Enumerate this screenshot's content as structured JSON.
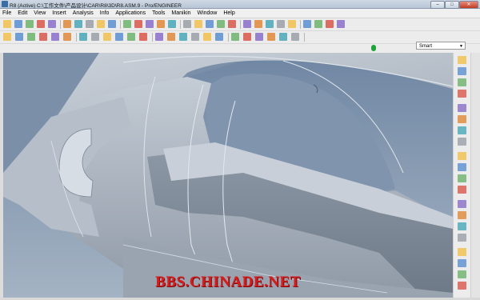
{
  "window": {
    "title": "R8 (Active) C:\\工作文件\\产品设计\\CAR\\R8\\3D\\R8.ASM.9 - Pro/ENGINEER",
    "minimize": "–",
    "maximize": "□",
    "close": "✕"
  },
  "menu": [
    "File",
    "Edit",
    "View",
    "Insert",
    "Analysis",
    "Info",
    "Applications",
    "Tools",
    "Manikin",
    "Window",
    "Help"
  ],
  "toolbar": {
    "row1_icons": [
      "new-icon",
      "open-icon",
      "save-icon",
      "print-icon",
      "email-icon",
      "copy-icon",
      "paste-icon",
      "repaint-icon",
      "spin-center-icon",
      "orient-icon",
      "model-tree-icon",
      "layer-icon",
      "view-manager-icon",
      "datum-plane-icon",
      "datum-axis-icon",
      "datum-point-icon",
      "csys-icon",
      "annotation-icon",
      "wireframe-icon",
      "hidden-line-icon",
      "no-hidden-icon",
      "shading-icon",
      "render-icon",
      "saved-views-icon",
      "zoom-in-icon",
      "zoom-out-icon",
      "refit-icon",
      "reorient-icon",
      "help-icon"
    ],
    "row2_icons": [
      "undo-icon",
      "redo-icon",
      "cut-icon",
      "copy2-icon",
      "paste2-icon",
      "regenerate-icon",
      "find-icon",
      "select-box-icon",
      "plane-icon",
      "axis-icon",
      "sketch-icon",
      "point-icon",
      "csys2-icon",
      "curve-icon",
      "analysis-icon",
      "mirror-icon",
      "merge-icon",
      "trim-icon",
      "intersect-icon",
      "project-icon",
      "wrap-icon",
      "offset-icon",
      "thicken-icon",
      "solidify-icon"
    ],
    "status_indicator_color": "#1fa33a"
  },
  "filter": {
    "value": "Smart"
  },
  "right_toolbar_icons": [
    "extrude-icon",
    "revolve-icon",
    "sweep-icon",
    "style-icon",
    "boundary-blend-icon",
    "hole-icon",
    "round-icon",
    "chamfer-icon",
    "draft-icon",
    "shell-icon",
    "rib-icon",
    "pattern-icon",
    "mirror-feature-icon",
    "merge-feature-icon",
    "trim-feature-icon",
    "offset-feature-icon",
    "thicken-feature-icon",
    "solidify-feature-icon",
    "flange-icon",
    "sketcher-icon"
  ],
  "watermark": "BBS.CHINADE.NET",
  "colors": {
    "viewport_bg": "#7e91a9",
    "body_panel": "#a9b3bf",
    "watermark": "#d81c1c"
  }
}
